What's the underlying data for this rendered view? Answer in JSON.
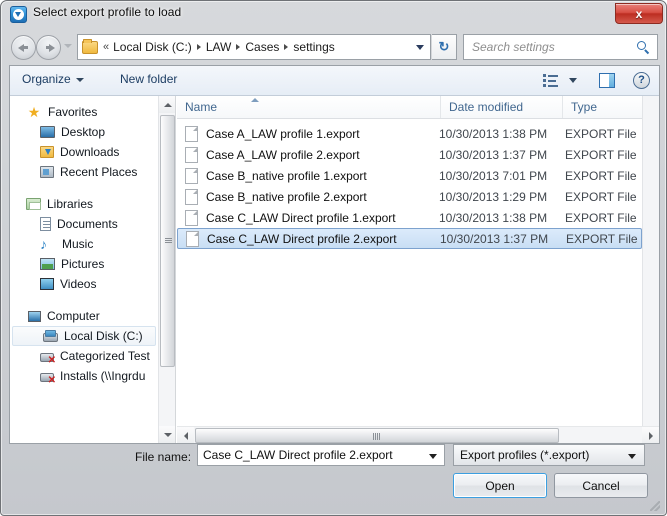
{
  "window": {
    "title": "Select export profile to load",
    "title_icon": "app-blue-chevron-icon",
    "close_label": "x"
  },
  "addressbar": {
    "back_icon": "back-arrow-icon",
    "forward_icon": "forward-arrow-icon",
    "recent_icon": "recent-locations-chevron-icon",
    "folder_icon": "folder-icon",
    "overflow": "«",
    "crumbs": [
      "Local Disk (C:)",
      "LAW",
      "Cases",
      "settings"
    ],
    "dropdown_icon": "chevron-down-icon",
    "refresh_icon": "refresh-icon",
    "refresh_glyph": "↻"
  },
  "search": {
    "placeholder": "Search settings",
    "icon": "search-icon"
  },
  "commandbar": {
    "organize_label": "Organize",
    "new_folder_label": "New folder",
    "view_icon": "view-list-icon",
    "view_caret_icon": "chevron-down-icon",
    "preview_pane_icon": "preview-pane-icon",
    "help_icon": "help-icon",
    "help_glyph": "?"
  },
  "navpane": {
    "groups": [
      {
        "header": {
          "label": "Favorites",
          "icon": "star-icon",
          "icon_class": "ico-star",
          "glyph": "★"
        },
        "items": [
          {
            "label": "Desktop",
            "icon": "desktop-icon",
            "icon_class": "ico-desktop"
          },
          {
            "label": "Downloads",
            "icon": "downloads-folder-icon",
            "icon_class": "ico-downloads"
          },
          {
            "label": "Recent Places",
            "icon": "recent-places-icon",
            "icon_class": "ico-recent"
          }
        ]
      },
      {
        "header": {
          "label": "Libraries",
          "icon": "libraries-icon",
          "icon_class": "ico-libraries",
          "glyph": ""
        },
        "items": [
          {
            "label": "Documents",
            "icon": "documents-icon",
            "icon_class": "ico-documents"
          },
          {
            "label": "Music",
            "icon": "music-note-icon",
            "icon_class": "ico-music",
            "glyph": "♪"
          },
          {
            "label": "Pictures",
            "icon": "pictures-icon",
            "icon_class": "ico-pictures"
          },
          {
            "label": "Videos",
            "icon": "videos-icon",
            "icon_class": "ico-videos"
          }
        ]
      },
      {
        "header": {
          "label": "Computer",
          "icon": "computer-icon",
          "icon_class": "ico-computer",
          "glyph": ""
        },
        "items": [
          {
            "label": "Local Disk (C:)",
            "icon": "local-disk-icon",
            "icon_class": "ico-disk",
            "selected": true
          },
          {
            "label": "Categorized Test",
            "icon": "network-drive-disconnected-icon",
            "icon_class": "ico-netdisk"
          },
          {
            "label": "Installs (\\\\Ingrdu",
            "icon": "network-drive-disconnected-icon",
            "icon_class": "ico-netdisk"
          }
        ]
      }
    ]
  },
  "filelist": {
    "columns": [
      "Name",
      "Date modified",
      "Type"
    ],
    "sort_column": "Name",
    "sort_direction": "ascending",
    "rows": [
      {
        "name": "Case A_LAW profile 1.export",
        "date": "10/30/2013 1:38 PM",
        "type": "EXPORT File",
        "selected": false
      },
      {
        "name": "Case A_LAW profile 2.export",
        "date": "10/30/2013 1:37 PM",
        "type": "EXPORT File",
        "selected": false
      },
      {
        "name": "Case B_native profile 1.export",
        "date": "10/30/2013 7:01 PM",
        "type": "EXPORT File",
        "selected": false
      },
      {
        "name": "Case B_native profile 2.export",
        "date": "10/30/2013 1:29 PM",
        "type": "EXPORT File",
        "selected": false
      },
      {
        "name": "Case C_LAW Direct profile 1.export",
        "date": "10/30/2013 1:38 PM",
        "type": "EXPORT File",
        "selected": false
      },
      {
        "name": "Case C_LAW Direct profile 2.export",
        "date": "10/30/2013 1:37 PM",
        "type": "EXPORT File",
        "selected": true
      }
    ]
  },
  "footer": {
    "filename_label": "File name:",
    "filename_value": "Case C_LAW Direct profile 2.export",
    "filetype_value": "Export profiles (*.export)",
    "open_label": "Open",
    "cancel_label": "Cancel"
  },
  "colors": {
    "selection_blue": "#c8def4",
    "selection_border": "#7da2ce",
    "accent_blue": "#2f6fae",
    "close_red": "#bc2d21",
    "header_text": "#41678f",
    "focus_ring": "#3c9fe0"
  }
}
